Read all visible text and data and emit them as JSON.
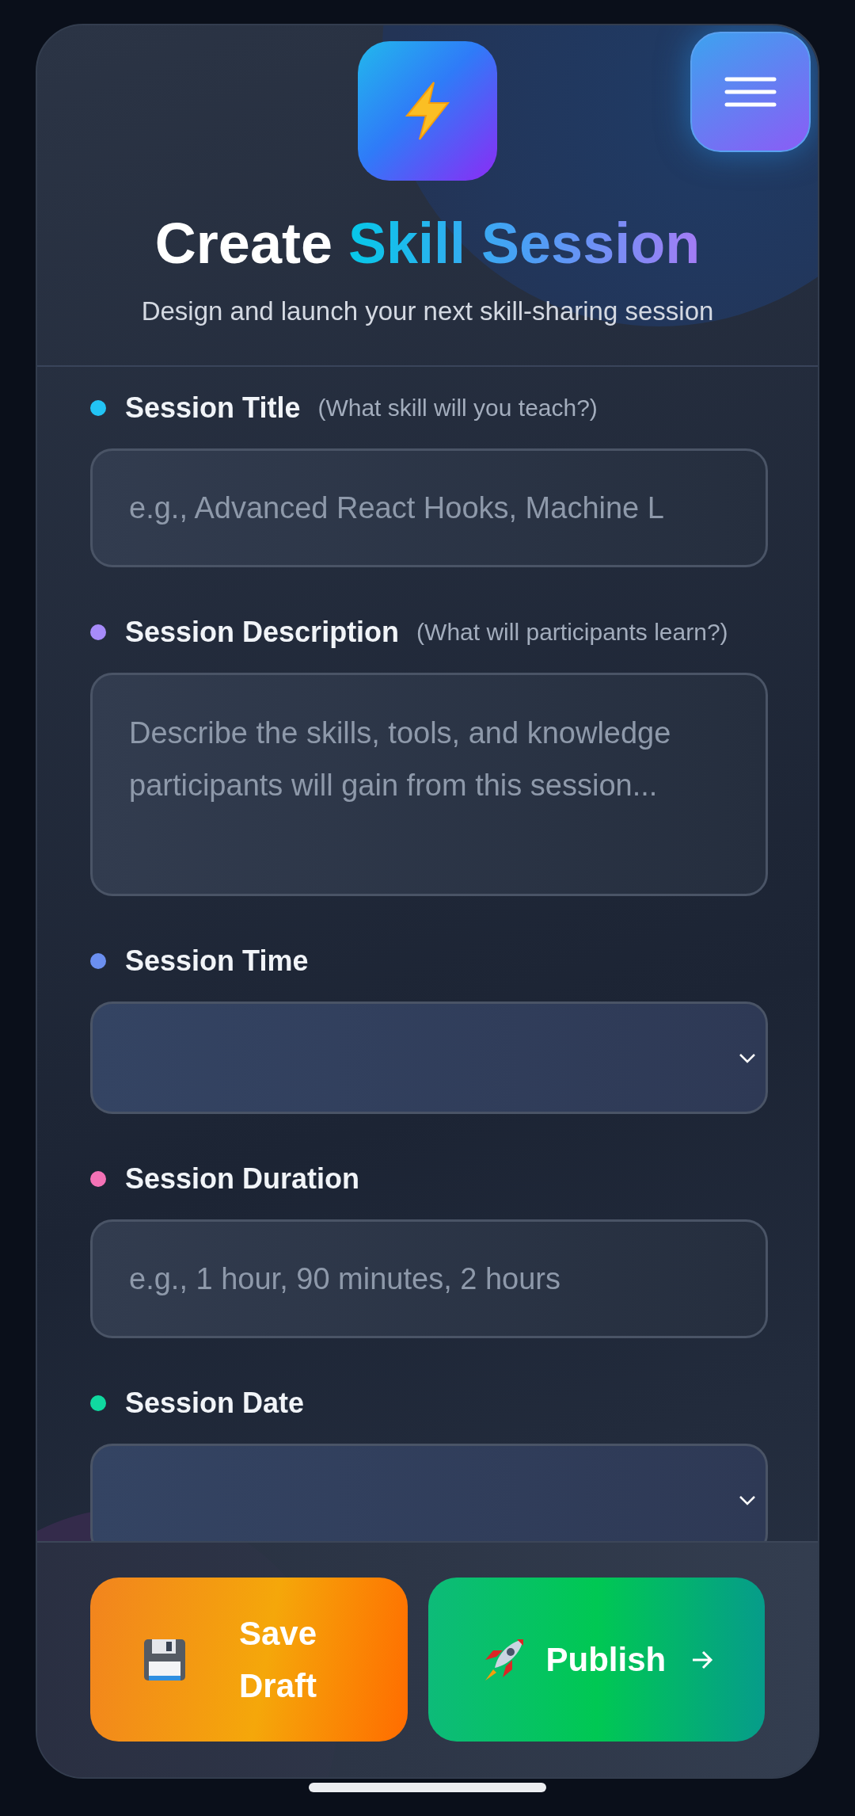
{
  "header": {
    "title": {
      "plain": "Create",
      "highlight": "Skill Session"
    },
    "subtitle": "Design and launch your next skill-sharing session"
  },
  "fields": [
    {
      "kind": "text",
      "label": "Session Title",
      "hint": "(What skill will you teach?)",
      "color": "#22c4f5",
      "placeholder": "e.g., Advanced React Hooks, Machine L"
    },
    {
      "kind": "textarea",
      "label": "Session Description",
      "hint": "(What will participants learn?)",
      "color": "#a78bfa",
      "placeholder": "Describe the skills, tools, and knowledge participants will gain from this session..."
    },
    {
      "kind": "select",
      "label": "Session Time",
      "color": "#6b8ff0"
    },
    {
      "kind": "text",
      "label": "Session Duration",
      "color": "#f472b6",
      "placeholder": "e.g., 1 hour, 90 minutes, 2 hours"
    },
    {
      "kind": "select",
      "label": "Session Date",
      "color": "#10d9a0"
    }
  ],
  "actions": [
    {
      "kind": "save",
      "label": "Save Draft"
    },
    {
      "kind": "publish",
      "label": "Publish"
    }
  ]
}
